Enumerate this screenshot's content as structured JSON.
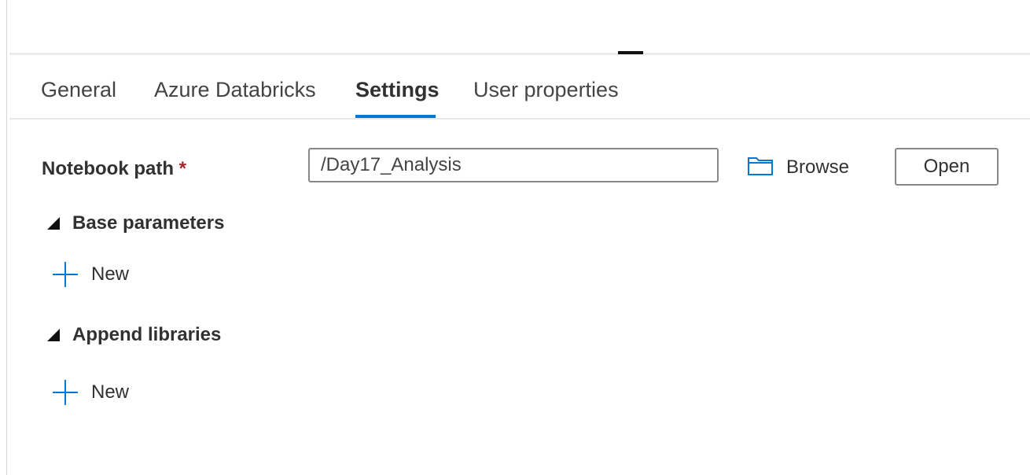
{
  "tabs": [
    {
      "label": "General",
      "active": false
    },
    {
      "label": "Azure Databricks",
      "active": false
    },
    {
      "label": "Settings",
      "active": true
    },
    {
      "label": "User properties",
      "active": false
    }
  ],
  "settings": {
    "notebook_path": {
      "label": "Notebook path",
      "required_marker": "*",
      "value": "/Day17_Analysis"
    },
    "browse_label": "Browse",
    "open_label": "Open",
    "sections": [
      {
        "title": "Base parameters",
        "new_label": "New",
        "expanded": true
      },
      {
        "title": "Append libraries",
        "new_label": "New",
        "expanded": true
      }
    ]
  },
  "colors": {
    "accent": "#0078d4",
    "required": "#a4262c",
    "text": "#323130",
    "border": "#8a8886"
  },
  "icons": {
    "browse": "folder-icon",
    "new": "plus-icon",
    "section_toggle": "collapse-triangle-icon"
  }
}
